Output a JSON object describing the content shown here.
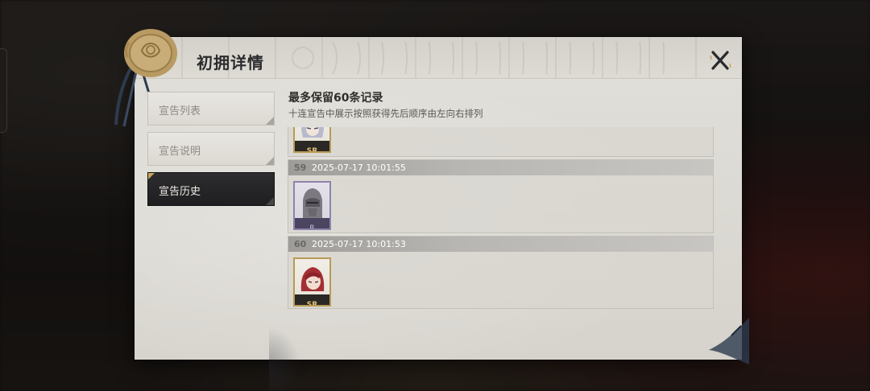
{
  "dialog": {
    "title": "初拥详情",
    "close_icon": "close-x-icon"
  },
  "sidebar": {
    "items": [
      {
        "label": "宣告列表",
        "active": false
      },
      {
        "label": "宣告说明",
        "active": false
      },
      {
        "label": "宣告历史",
        "active": true
      }
    ]
  },
  "content": {
    "title": "最多保留60条记录",
    "subtitle": "十连宣告中展示按照获得先后顺序由左向右排列",
    "records": [
      {
        "index": "",
        "time": "",
        "card": {
          "rarity": "SR",
          "character": "silver-haired-character-portrait"
        }
      },
      {
        "index": "59",
        "time": "2025-07-17  10:01:55",
        "card": {
          "rarity": "R",
          "character": "armored-helmet-character-portrait"
        }
      },
      {
        "index": "60",
        "time": "2025-07-17  10:01:53",
        "card": {
          "rarity": "SR",
          "character": "red-haired-character-portrait"
        }
      }
    ]
  },
  "colors": {
    "panel": "#dcdad4",
    "active_tab": "#232224",
    "sr_gold": "#b99a56",
    "r_purple": "#8e83ad"
  }
}
